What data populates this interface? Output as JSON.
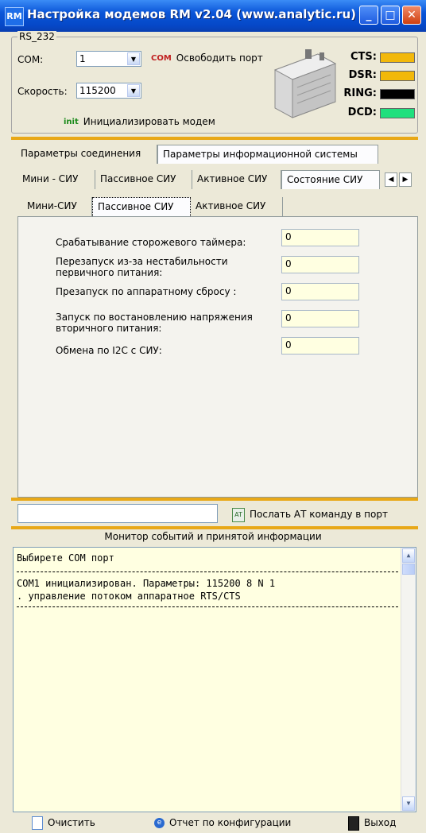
{
  "window": {
    "app_icon": "RM",
    "title": "Настройка модемов RM v2.04 (www.analytic.ru)",
    "min_glyph": "_",
    "max_glyph": "□",
    "close_glyph": "✕"
  },
  "rs232": {
    "group_title": "RS_232",
    "com_label": "COM:",
    "com_value": "1",
    "speed_label": "Скорость:",
    "speed_value": "115200",
    "release_icon": "COM",
    "release_label": "Освободить порт",
    "init_icon": "init",
    "init_label": "Инициализировать модем"
  },
  "indicators": [
    {
      "label": "CTS:",
      "color": "#F2B80A"
    },
    {
      "label": "DSR:",
      "color": "#F2B80A"
    },
    {
      "label": "RING:",
      "color": "#000000"
    },
    {
      "label": "DCD:",
      "color": "#1FE07D"
    }
  ],
  "tabs_level1": [
    "Параметры соединения",
    "Параметры информационной системы"
  ],
  "tabs_level2": [
    "Мини - СИУ",
    "Пассивное СИУ",
    "Активное СИУ",
    "Состояние СИУ"
  ],
  "tabs_level3": [
    "Мини-СИУ",
    "Пассивное СИУ",
    "Активное СИУ"
  ],
  "fields": [
    {
      "label": "Срабатывание сторожевого таймера:",
      "value": "0"
    },
    {
      "label": "Перезапуск из-за нестабильности первичного питания:",
      "value": "0"
    },
    {
      "label": "Презапуск по аппаратному сбросу :",
      "value": "0"
    },
    {
      "label": "Запуск по востановлению напряжения вторичного питания:",
      "value": "0"
    },
    {
      "label": "Обмена по I2C с СИУ:",
      "value": "0"
    }
  ],
  "at": {
    "input_value": "",
    "send_label": "Послать АТ команду в порт"
  },
  "monitor": {
    "title": "Монитор событий и принятой информации",
    "lines": [
      "Выбирете COM порт",
      "COM1 инициализирован. Параметры: 115200 8 N 1",
      ". управление потоком аппаратное RTS/CTS"
    ]
  },
  "bottom": {
    "clear_label": "Очистить",
    "report_label": "Отчет по конфигурации",
    "exit_label": "Выход"
  }
}
